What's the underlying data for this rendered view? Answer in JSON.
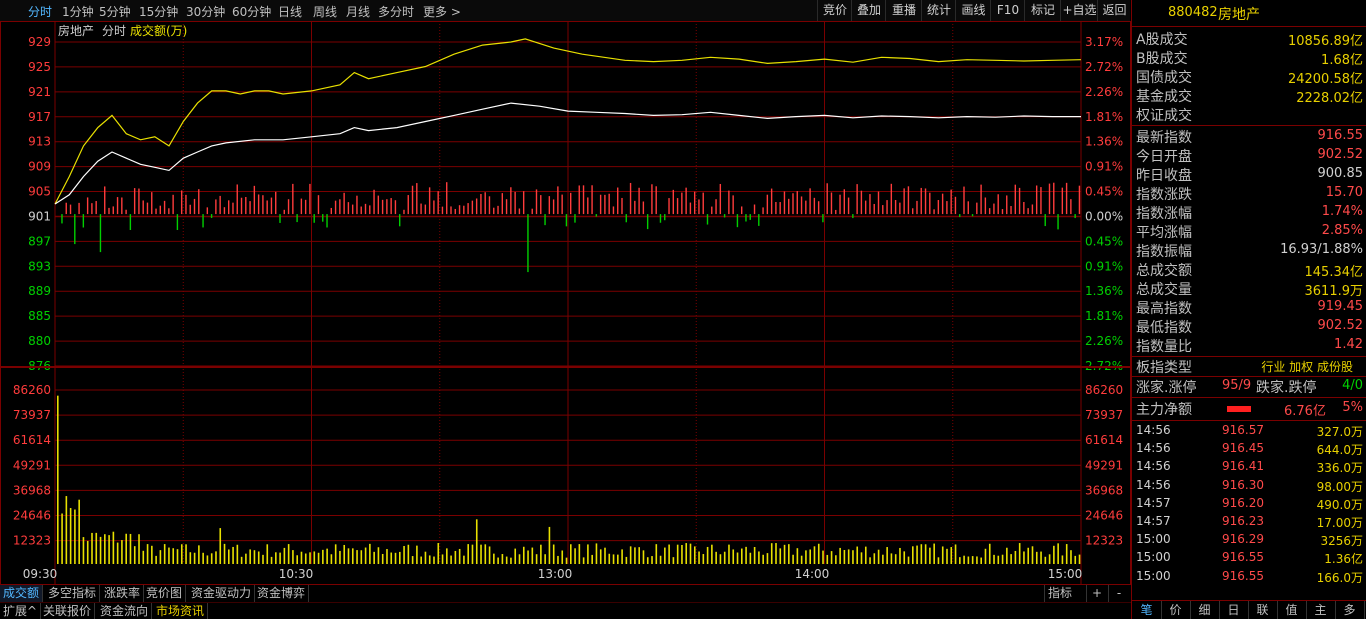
{
  "topbar": {
    "periods": [
      "分时",
      "1分钟",
      "5分钟",
      "15分钟",
      "30分钟",
      "60分钟",
      "日线",
      "周线",
      "月线",
      "多分时",
      "更多 >"
    ],
    "tools": [
      "竞价",
      "叠加",
      "重播",
      "统计",
      "画线",
      "F10",
      "标记",
      "+自选",
      "返回"
    ]
  },
  "chart": {
    "name": "房地产",
    "mode": "分时",
    "indicator_label": "成交额(万)",
    "price_ticks": [
      "929",
      "925",
      "921",
      "917",
      "913",
      "909",
      "905",
      "901",
      "897",
      "893",
      "889",
      "885",
      "880",
      "876"
    ],
    "pct_ticks": [
      "3.17%",
      "2.72%",
      "2.26%",
      "1.81%",
      "1.36%",
      "0.91%",
      "0.45%",
      "0.00%",
      "0.45%",
      "0.91%",
      "1.36%",
      "1.81%",
      "2.26%",
      "2.72%"
    ],
    "volume_ticks": [
      "86260",
      "73937",
      "61614",
      "49291",
      "36968",
      "24646",
      "12323"
    ],
    "time_ticks": [
      "09:30",
      "10:30",
      "13:00",
      "14:00",
      "15:00"
    ],
    "colors": {
      "up": "#ff3c3c",
      "down": "#00d000",
      "price_line": "#ffffff",
      "avg_line": "#e8e000",
      "grid": "#7a0000"
    }
  },
  "bottom_tabs": [
    "成交额",
    "多空指标",
    "涨跌率",
    "竞价图",
    "资金驱动力",
    "资金博弈"
  ],
  "bottom_right": {
    "indicator": "指标",
    "plus": "+",
    "minus": "-"
  },
  "status_bar": [
    "扩展^",
    "关联报价",
    "资金流向",
    "市场资讯"
  ],
  "panel": {
    "code": "880482",
    "name": "房地产",
    "market_rows": [
      {
        "label": "A股成交",
        "value": "10856.89亿"
      },
      {
        "label": "B股成交",
        "value": "1.68亿"
      },
      {
        "label": "国债成交",
        "value": "24200.58亿"
      },
      {
        "label": "基金成交",
        "value": "2228.02亿"
      },
      {
        "label": "权证成交",
        "value": ""
      }
    ],
    "index_rows": [
      {
        "label": "最新指数",
        "value": "916.55",
        "color": "#ff4a4a"
      },
      {
        "label": "今日开盘",
        "value": "902.52",
        "color": "#ff4a4a"
      },
      {
        "label": "昨日收盘",
        "value": "900.85",
        "color": "#d0d0d0"
      },
      {
        "label": "指数涨跌",
        "value": "15.70",
        "color": "#ff4a4a"
      },
      {
        "label": "指数涨幅",
        "value": "1.74%",
        "color": "#ff4a4a"
      },
      {
        "label": "平均涨幅",
        "value": "2.85%",
        "color": "#ff4a4a"
      },
      {
        "label": "指数振幅",
        "value": "16.93/1.88%",
        "color": "#d0d0d0"
      },
      {
        "label": "总成交额",
        "value": "145.34亿",
        "color": "#e8d000"
      },
      {
        "label": "总成交量",
        "value": "3611.9万",
        "color": "#e8d000"
      },
      {
        "label": "最高指数",
        "value": "919.45",
        "color": "#ff4a4a"
      },
      {
        "label": "最低指数",
        "value": "902.52",
        "color": "#ff4a4a"
      },
      {
        "label": "指数量比",
        "value": "1.42",
        "color": "#ff4a4a"
      }
    ],
    "board_type_label": "板指类型",
    "board_type_value": "行业 加权 成份股",
    "rise_label": "涨家.涨停",
    "rise_value": "95/9",
    "fall_label": "跌家.跌停",
    "fall_value": "4/0",
    "main_flow_label": "主力净额",
    "main_flow_value": "6.76亿",
    "main_flow_pct": "5%",
    "ticks": [
      {
        "time": "14:56",
        "price": "916.57",
        "vol": "327.0万"
      },
      {
        "time": "14:56",
        "price": "916.45",
        "vol": "644.0万"
      },
      {
        "time": "14:56",
        "price": "916.41",
        "vol": "336.0万"
      },
      {
        "time": "14:56",
        "price": "916.30",
        "vol": "98.00万"
      },
      {
        "time": "14:57",
        "price": "916.20",
        "vol": "490.0万"
      },
      {
        "time": "14:57",
        "price": "916.23",
        "vol": "17.00万"
      },
      {
        "time": "15:00",
        "price": "916.29",
        "vol": "3256万"
      },
      {
        "time": "15:00",
        "price": "916.55",
        "vol": "1.36亿"
      },
      {
        "time": "15:00",
        "price": "916.55",
        "vol": "166.0万"
      }
    ],
    "tabs": [
      "笔",
      "价",
      "细",
      "日",
      "联",
      "值",
      "主",
      "多"
    ]
  },
  "chart_data": {
    "type": "line",
    "title": "房地产",
    "x_range": [
      "09:30",
      "15:00"
    ],
    "y_range": [
      876,
      929
    ],
    "prev_close": 900.85,
    "series": [
      {
        "name": "price",
        "points": [
          [
            0,
            902.5
          ],
          [
            5,
            907
          ],
          [
            10,
            912
          ],
          [
            15,
            915
          ],
          [
            20,
            917
          ],
          [
            25,
            914
          ],
          [
            30,
            913
          ],
          [
            35,
            913.5
          ],
          [
            40,
            912
          ],
          [
            45,
            916
          ],
          [
            50,
            919
          ],
          [
            55,
            921
          ],
          [
            60,
            921
          ],
          [
            65,
            920.5
          ],
          [
            70,
            921
          ],
          [
            75,
            921
          ],
          [
            80,
            920.5
          ],
          [
            90,
            921
          ],
          [
            100,
            922
          ],
          [
            105,
            924
          ],
          [
            110,
            923
          ],
          [
            120,
            924
          ],
          [
            130,
            925
          ],
          [
            140,
            927
          ],
          [
            150,
            928.5
          ],
          [
            160,
            929
          ],
          [
            165,
            929.5
          ],
          [
            175,
            928
          ],
          [
            185,
            927
          ],
          [
            200,
            926
          ],
          [
            210,
            925.8
          ],
          [
            220,
            926
          ],
          [
            230,
            926.5
          ],
          [
            240,
            926.2
          ],
          [
            250,
            925.5
          ],
          [
            260,
            925.8
          ],
          [
            270,
            926.2
          ],
          [
            280,
            925.7
          ],
          [
            290,
            926.5
          ],
          [
            300,
            926.3
          ],
          [
            310,
            925.8
          ],
          [
            320,
            926.1
          ],
          [
            330,
            926
          ],
          [
            340,
            925.9
          ],
          [
            350,
            926
          ],
          [
            360,
            926.1
          ]
        ]
      },
      {
        "name": "average",
        "points": [
          [
            0,
            902.5
          ],
          [
            5,
            904
          ],
          [
            10,
            907
          ],
          [
            15,
            909.5
          ],
          [
            20,
            911
          ],
          [
            25,
            910
          ],
          [
            30,
            909
          ],
          [
            35,
            908.5
          ],
          [
            40,
            908
          ],
          [
            45,
            910
          ],
          [
            50,
            911
          ],
          [
            55,
            912
          ],
          [
            60,
            912.5
          ],
          [
            70,
            913
          ],
          [
            80,
            913
          ],
          [
            90,
            913.5
          ],
          [
            100,
            914
          ],
          [
            105,
            915
          ],
          [
            110,
            914.5
          ],
          [
            120,
            915
          ],
          [
            130,
            916
          ],
          [
            140,
            917
          ],
          [
            150,
            918
          ],
          [
            160,
            919
          ],
          [
            170,
            918.5
          ],
          [
            180,
            917.7
          ],
          [
            190,
            917.5
          ],
          [
            200,
            917.3
          ],
          [
            210,
            917
          ],
          [
            220,
            917.1
          ],
          [
            230,
            917.5
          ],
          [
            240,
            917
          ],
          [
            250,
            916.5
          ],
          [
            260,
            916.8
          ],
          [
            270,
            917
          ],
          [
            280,
            916.6
          ],
          [
            290,
            916.9
          ],
          [
            300,
            916.8
          ],
          [
            310,
            916.6
          ],
          [
            320,
            916.8
          ],
          [
            330,
            916.7
          ],
          [
            340,
            916.9
          ],
          [
            350,
            916.8
          ],
          [
            360,
            916.8
          ]
        ]
      }
    ],
    "volume_max": 86260
  }
}
